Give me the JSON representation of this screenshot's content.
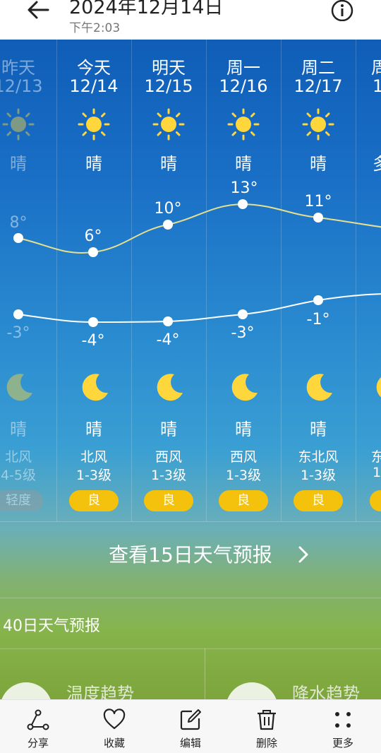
{
  "header": {
    "title": "2024年12月14日",
    "subtitle": "下午2:03"
  },
  "days": [
    {
      "day": "昨天",
      "date": "12/13",
      "day_condition": "晴",
      "high": "8°",
      "low": "-3°",
      "night_condition": "晴",
      "wind": "北风",
      "wind_level": "4-5级",
      "aqi": "轻度",
      "past": true
    },
    {
      "day": "今天",
      "date": "12/14",
      "day_condition": "晴",
      "high": "6°",
      "low": "-4°",
      "night_condition": "晴",
      "wind": "北风",
      "wind_level": "1-3级",
      "aqi": "良",
      "past": false
    },
    {
      "day": "明天",
      "date": "12/15",
      "day_condition": "晴",
      "high": "10°",
      "low": "-4°",
      "night_condition": "晴",
      "wind": "西风",
      "wind_level": "1-3级",
      "aqi": "良",
      "past": false
    },
    {
      "day": "周一",
      "date": "12/16",
      "day_condition": "晴",
      "high": "13°",
      "low": "-3°",
      "night_condition": "晴",
      "wind": "西风",
      "wind_level": "1-3级",
      "aqi": "良",
      "past": false
    },
    {
      "day": "周二",
      "date": "12/17",
      "day_condition": "晴",
      "high": "11°",
      "low": "-1°",
      "night_condition": "晴",
      "wind": "东北风",
      "wind_level": "1-3级",
      "aqi": "良",
      "past": false
    },
    {
      "day": "周",
      "date": "1",
      "day_condition": "多",
      "high": "",
      "low": "",
      "night_condition": "",
      "wind": "东",
      "wind_level": "1",
      "aqi": "",
      "past": false
    }
  ],
  "forecast_15_label": "查看15日天气预报",
  "forecast_40_label": "40日天气预报",
  "cards": {
    "temp_trend": "温度趋势",
    "precip_trend": "降水趋势"
  },
  "toolbar": {
    "share": "分享",
    "favorite": "收藏",
    "edit": "编辑",
    "delete": "删除",
    "more": "更多"
  },
  "colors": {
    "aqi_good": "#f4c20d",
    "sun": "#ffd73c",
    "high_line": "#e6e08c",
    "low_line": "#ffffff"
  }
}
